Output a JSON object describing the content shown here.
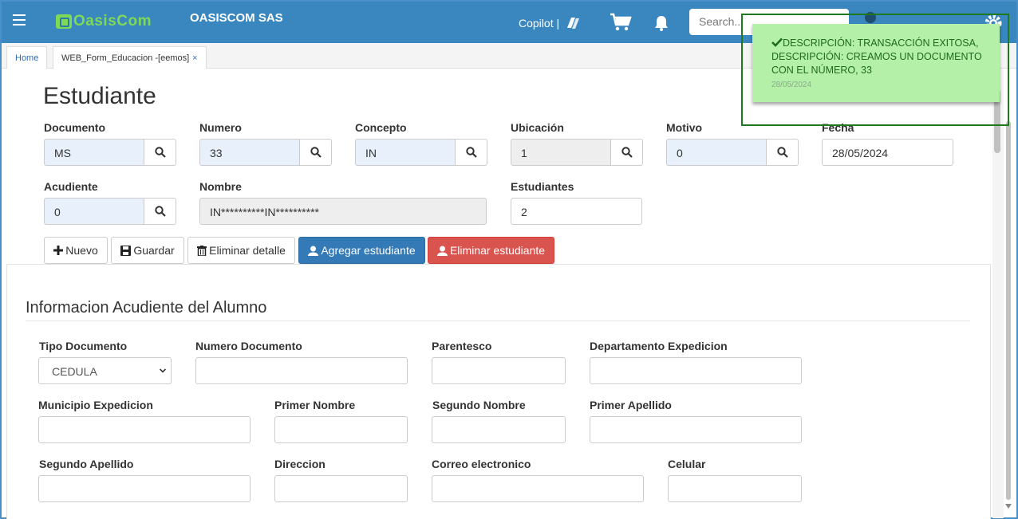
{
  "header": {
    "logo_text": "OasisCom",
    "company": "OASISCOM SAS",
    "copilot_label": "Copilot |",
    "search_placeholder": "Search..."
  },
  "tabs": [
    {
      "label": "Home"
    },
    {
      "label": "WEB_Form_Educacion -[eemos]",
      "close": "×"
    }
  ],
  "page": {
    "title": "Estudiante"
  },
  "fields": {
    "documento": {
      "label": "Documento",
      "value": "MS"
    },
    "numero": {
      "label": "Numero",
      "value": "33"
    },
    "concepto": {
      "label": "Concepto",
      "value": "IN"
    },
    "ubicacion": {
      "label": "Ubicación",
      "value": "1"
    },
    "motivo": {
      "label": "Motivo",
      "value": "0"
    },
    "fecha": {
      "label": "Fecha",
      "value": "28/05/2024"
    },
    "acudiente": {
      "label": "Acudiente",
      "value": "0"
    },
    "nombre": {
      "label": "Nombre",
      "value": "IN**********IN**********"
    },
    "estudiantes": {
      "label": "Estudiantes",
      "value": "2"
    }
  },
  "actions": {
    "nuevo": "Nuevo",
    "guardar": "Guardar",
    "eliminar_detalle": "Eliminar detalle",
    "agregar_estudiante": "Agregar estudiante",
    "eliminar_estudiante": "Eliminar estudiante"
  },
  "guardian_section": {
    "title": "Informacion Acudiente del Alumno",
    "tipo_documento": {
      "label": "Tipo Documento",
      "value": "CEDULA"
    },
    "numero_documento": {
      "label": "Numero Documento",
      "value": ""
    },
    "parentesco": {
      "label": "Parentesco",
      "value": ""
    },
    "departamento": {
      "label": "Departamento Expedicion",
      "value": ""
    },
    "municipio": {
      "label": "Municipio Expedicion",
      "value": ""
    },
    "primer_nombre": {
      "label": "Primer Nombre",
      "value": ""
    },
    "segundo_nombre": {
      "label": "Segundo Nombre",
      "value": ""
    },
    "primer_apellido": {
      "label": "Primer Apellido",
      "value": ""
    },
    "segundo_apellido": {
      "label": "Segundo Apellido",
      "value": ""
    },
    "direccion": {
      "label": "Direccion",
      "value": ""
    },
    "correo": {
      "label": "Correo electronico",
      "value": ""
    },
    "celular": {
      "label": "Celular",
      "value": ""
    }
  },
  "toast": {
    "line1": "DESCRIPCIÓN: TRANSACCIÓN EXITOSA,",
    "line2": "DESCRIPCIÓN: CREAMOS UN DOCUMENTO",
    "line3": "CON EL NÚMERO, 33",
    "date": "28/05/2024"
  },
  "colors": {
    "header_bg": "#3a87c0",
    "primary": "#337ab7",
    "danger": "#d9534f",
    "toast_bg": "#b4f0a8",
    "logo_green": "#7ed957"
  }
}
